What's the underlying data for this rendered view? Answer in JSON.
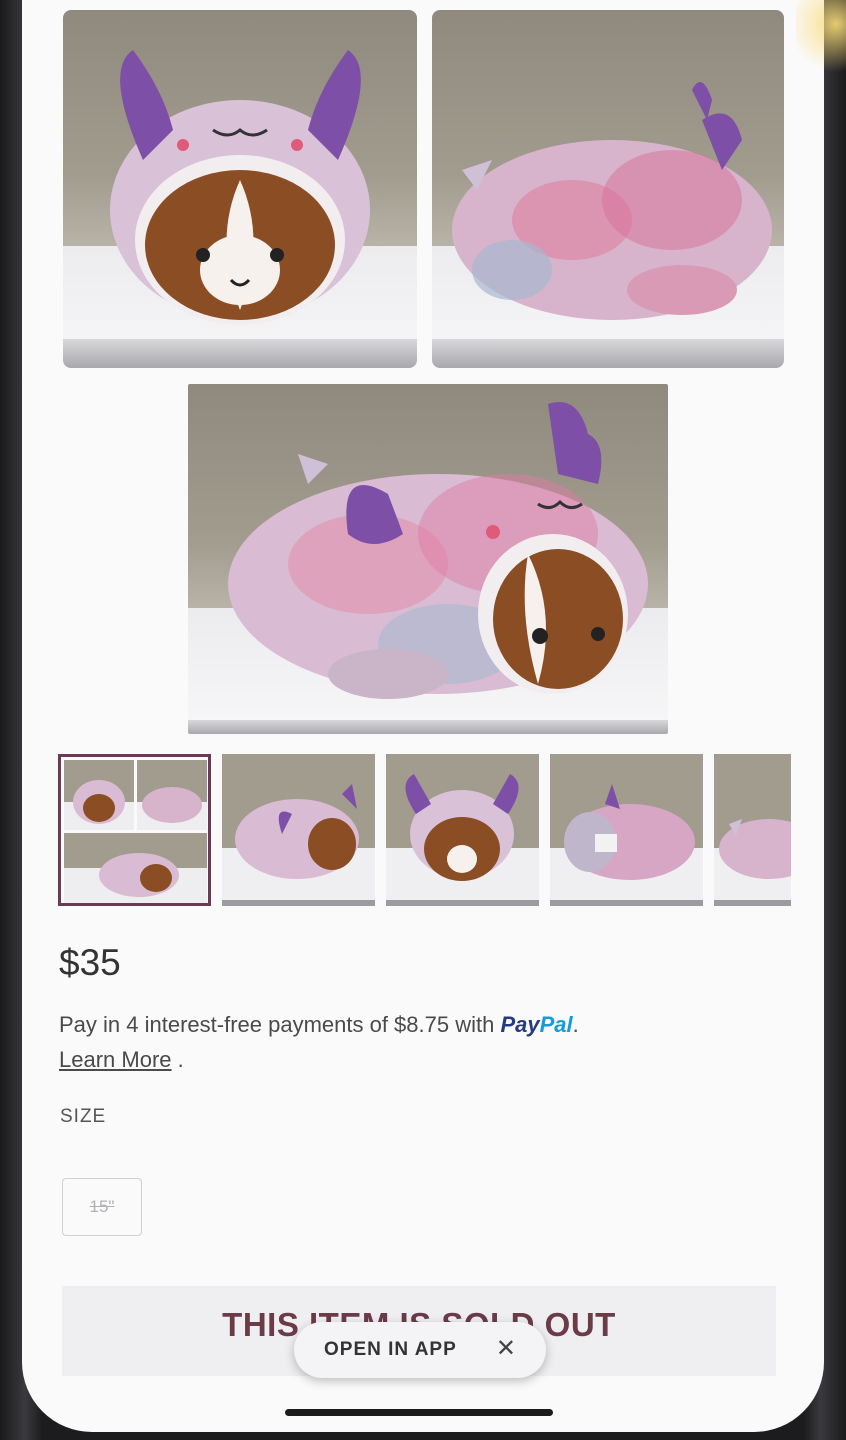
{
  "product": {
    "images": [
      {
        "alt": "front-view"
      },
      {
        "alt": "side-view"
      },
      {
        "alt": "three-quarter-view"
      }
    ],
    "thumbnails": 5,
    "price": "$35",
    "payment": {
      "text": "Pay in 4 interest-free payments of $8.75 with",
      "paypal_a": "Pay",
      "paypal_b": "Pal",
      "period": ".",
      "learn_more": "Learn More",
      "learn_suffix": " ."
    },
    "size": {
      "label": "SIZE",
      "options": [
        "15\""
      ],
      "selected": "15\"",
      "available": false
    },
    "sold_out": "THIS ITEM IS SOLD OUT"
  },
  "app_banner": {
    "open_label": "OPEN IN APP",
    "close_icon": "close-icon"
  },
  "colors": {
    "accent": "#6a3b55",
    "sold_text": "#6b3b47",
    "paypal_dark": "#253b80",
    "paypal_light": "#179bd7"
  }
}
